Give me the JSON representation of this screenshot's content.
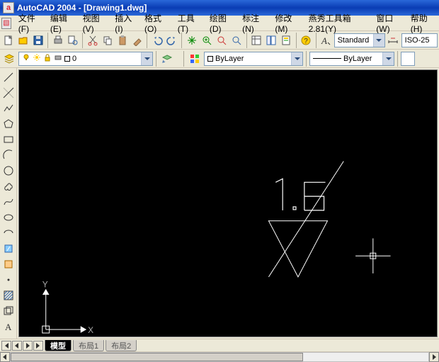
{
  "titlebar": {
    "app_name": "AutoCAD 2004",
    "doc_name": "[Drawing1.dwg]"
  },
  "menu": {
    "file": "文件(F)",
    "edit": "编辑(E)",
    "view": "视图(V)",
    "insert": "插入(I)",
    "format": "格式(O)",
    "tools": "工具(T)",
    "draw": "绘图(D)",
    "dim": "标注(N)",
    "modify": "修改(M)",
    "yanxiu": "燕秀工具箱2.81(Y)",
    "window": "窗口(W)",
    "help": "帮助(H)"
  },
  "toolbar_std": {
    "style_label": "Standard",
    "dimstyle_label": "ISO-25"
  },
  "layer_row": {
    "layer_value": "0",
    "color_value": "ByLayer",
    "linetype_value": "ByLayer"
  },
  "canvas": {
    "annotation_value": "1.6",
    "x_axis_label": "X",
    "y_axis_label": "Y"
  },
  "tabs": {
    "model": "模型",
    "layout1": "布局1",
    "layout2": "布局2"
  }
}
